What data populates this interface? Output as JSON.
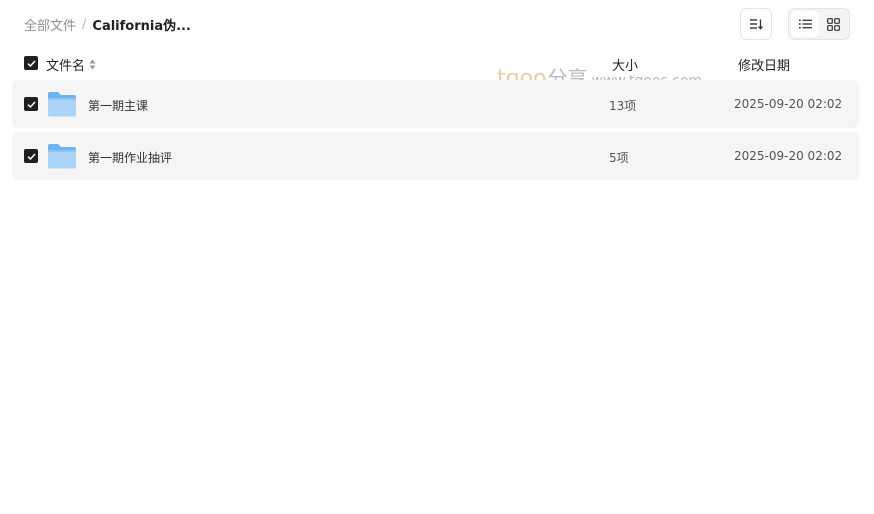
{
  "breadcrumb": {
    "root": "全部文件",
    "separator": "/",
    "current": "California伪..."
  },
  "toolbar": {
    "sort_icon": "sort-icon",
    "list_view_icon": "list-view-icon",
    "grid_view_icon": "grid-view-icon",
    "active_view": "list"
  },
  "columns": {
    "name": "文件名",
    "size": "大小",
    "date": "修改日期"
  },
  "watermark": {
    "logo_part1": "tgoo",
    "logo_part2": "分享",
    "url": "www.tgoos.com"
  },
  "files": [
    {
      "name": "第一期主课",
      "size": "13项",
      "date": "2025-09-20 02:02",
      "checked": true,
      "icon": "folder-icon"
    },
    {
      "name": "第一期作业抽评",
      "size": "5项",
      "date": "2025-09-20 02:02",
      "checked": true,
      "icon": "folder-icon"
    }
  ],
  "colors": {
    "checkbox": "#1f1f1f",
    "row_bg": "#f5f5f6",
    "folder_light": "#a9d4f7",
    "folder_dark": "#6db3ef"
  }
}
